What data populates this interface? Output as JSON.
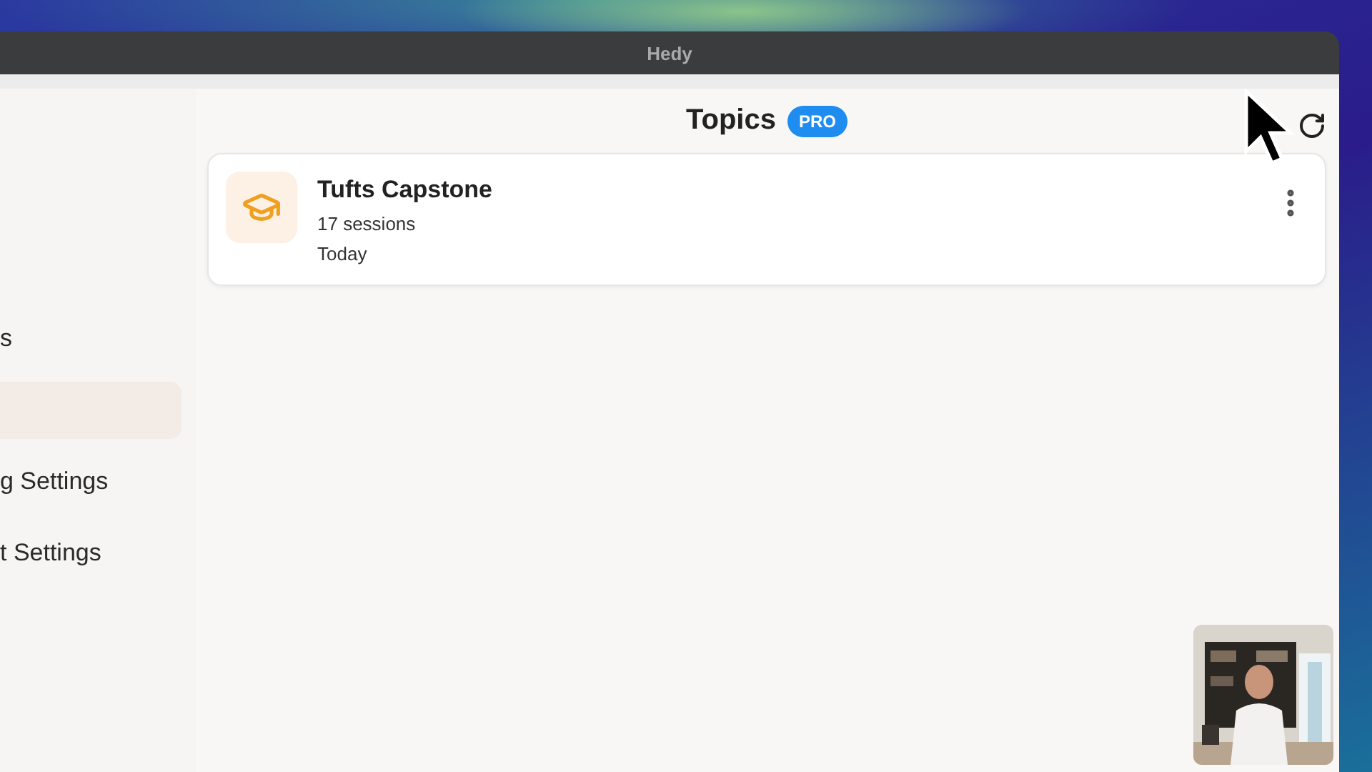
{
  "window": {
    "title": "Hedy"
  },
  "sidebar": {
    "items": [
      {
        "label": "s",
        "selected": false
      },
      {
        "selected": true
      },
      {
        "label": "g Settings",
        "selected": false
      },
      {
        "label": "t Settings",
        "selected": false
      }
    ]
  },
  "header": {
    "title": "Topics",
    "badge": "PRO"
  },
  "topics": [
    {
      "title": "Tufts Capstone",
      "sessions": "17 sessions",
      "date": "Today"
    }
  ]
}
